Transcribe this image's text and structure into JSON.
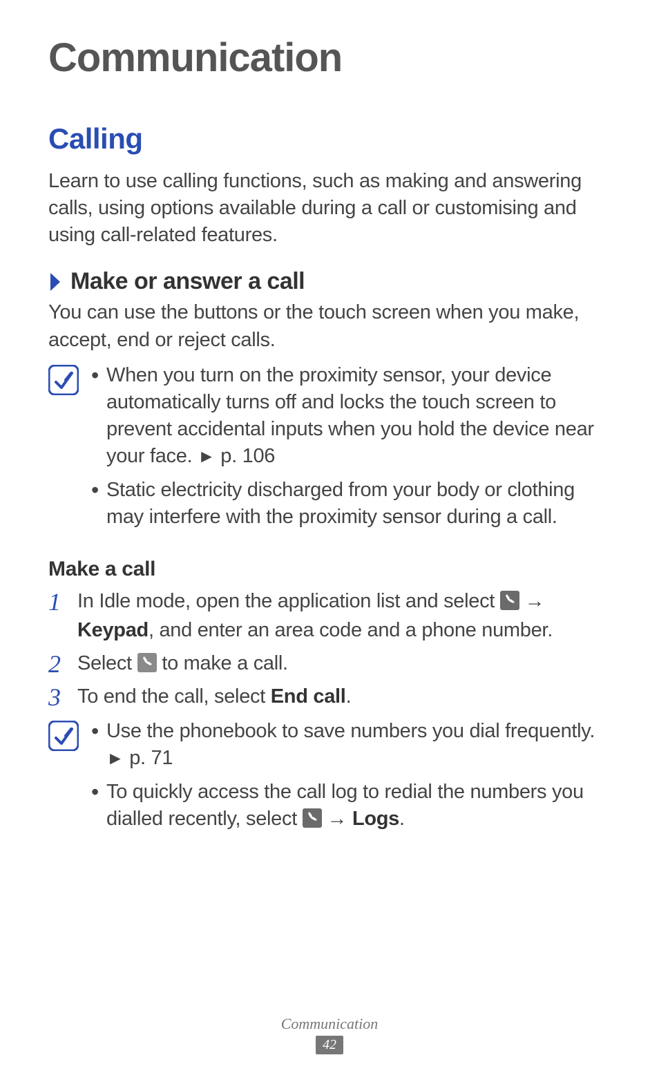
{
  "page": {
    "title": "Communication",
    "section_heading": "Calling",
    "section_intro": "Learn to use calling functions, such as making and answering calls, using options available during a call or customising and using call-related features.",
    "subsection_prefix_icon": "chevron-right-icon",
    "subsection_heading": "Make or answer a call",
    "subsection_intro": "You can use the buttons or the touch screen when you make, accept, end or reject calls.",
    "notes_a": [
      {
        "prefix": "When you turn on the proximity sensor, your device automatically turns off and locks the touch screen to prevent accidental inputs when you hold the device near your face. ",
        "ref_marker": "►",
        "ref_text": " p. 106"
      },
      {
        "prefix": "Static electricity discharged from your body or clothing may interfere with the proximity sensor during a call.",
        "ref_marker": "",
        "ref_text": ""
      }
    ],
    "make_a_call_heading": "Make a call",
    "steps": [
      {
        "num": "1",
        "pre": "In Idle mode, open the application list and select ",
        "icon": "phone-icon",
        "arrow": " → ",
        "bold": "Keypad",
        "post": ", and enter an area code and a phone number."
      },
      {
        "num": "2",
        "pre": "Select ",
        "icon": "phone-call-icon",
        "arrow": "",
        "bold": "",
        "post": " to make a call."
      },
      {
        "num": "3",
        "pre": "To end the call, select ",
        "icon": "",
        "arrow": "",
        "bold": "End call",
        "post": "."
      }
    ],
    "notes_b": [
      {
        "prefix": "Use the phonebook to save numbers you dial frequently. ",
        "ref_marker": "►",
        "ref_text": " p. 71",
        "icon": "",
        "arrow": "",
        "bold": ""
      },
      {
        "prefix": "To quickly access the call log to redial the numbers you dialled recently, select ",
        "ref_marker": "",
        "ref_text": "",
        "icon": "phone-icon",
        "arrow": " → ",
        "bold": "Logs",
        "post": "."
      }
    ],
    "footer_label": "Communication",
    "footer_page": "42"
  }
}
